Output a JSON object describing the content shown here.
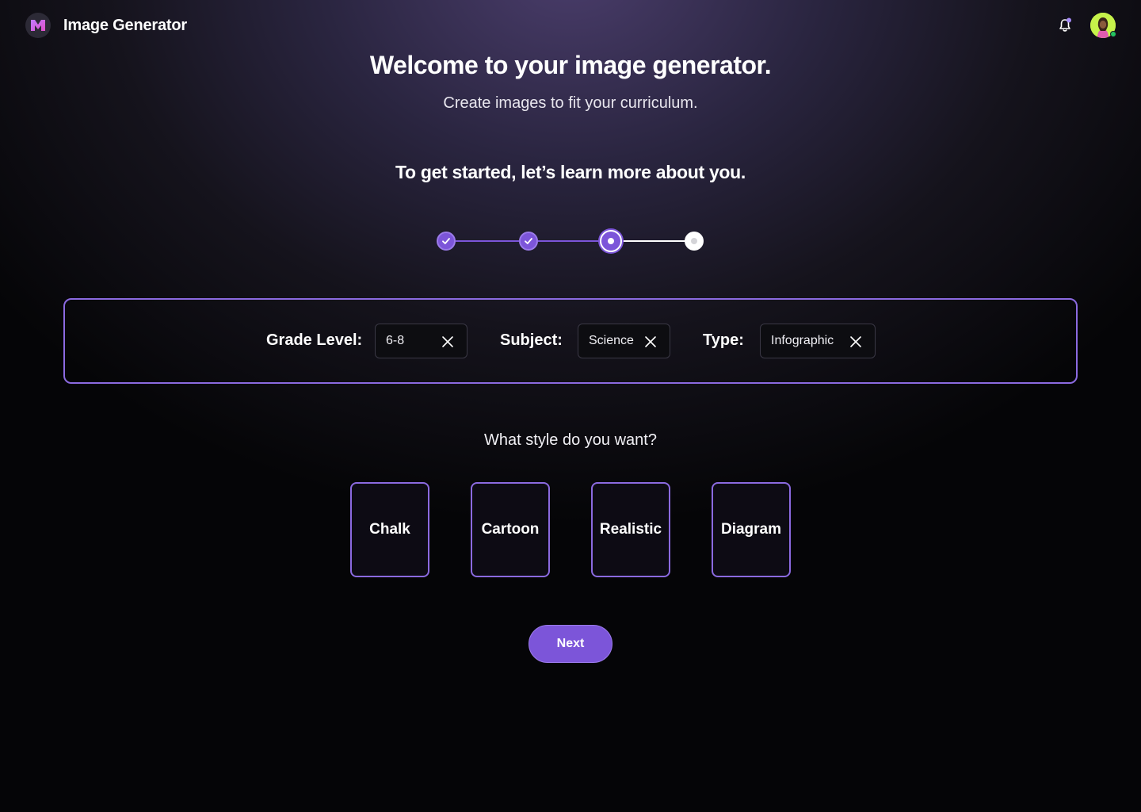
{
  "header": {
    "app_title": "Image Generator",
    "logo_icon": "m-logo-icon",
    "notification_icon": "bell-icon",
    "avatar_status_color": "#22c55e"
  },
  "main": {
    "title": "Welcome to your image generator.",
    "subtitle": "Create images to fit your curriculum.",
    "section_heading": "To get started, let’s learn more about you.",
    "stepper": {
      "steps": [
        {
          "state": "completed",
          "icon": "check-icon"
        },
        {
          "state": "completed",
          "icon": "check-icon"
        },
        {
          "state": "current"
        },
        {
          "state": "upcoming"
        }
      ],
      "current_step": 3,
      "total_steps": 4
    },
    "filters": {
      "grade_level": {
        "label": "Grade Level:",
        "value": "6-8"
      },
      "subject": {
        "label": "Subject:",
        "value": "Science"
      },
      "type": {
        "label": "Type:",
        "value": "Infographic"
      }
    },
    "style_question": "What style do you want?",
    "styles": [
      {
        "label": "Chalk"
      },
      {
        "label": "Cartoon"
      },
      {
        "label": "Realistic"
      },
      {
        "label": "Diagram"
      }
    ],
    "next_label": "Next"
  },
  "colors": {
    "accent": "#7c55d9",
    "accent_border": "#8b6ae0",
    "avatar_bg": "#c6f24a"
  }
}
